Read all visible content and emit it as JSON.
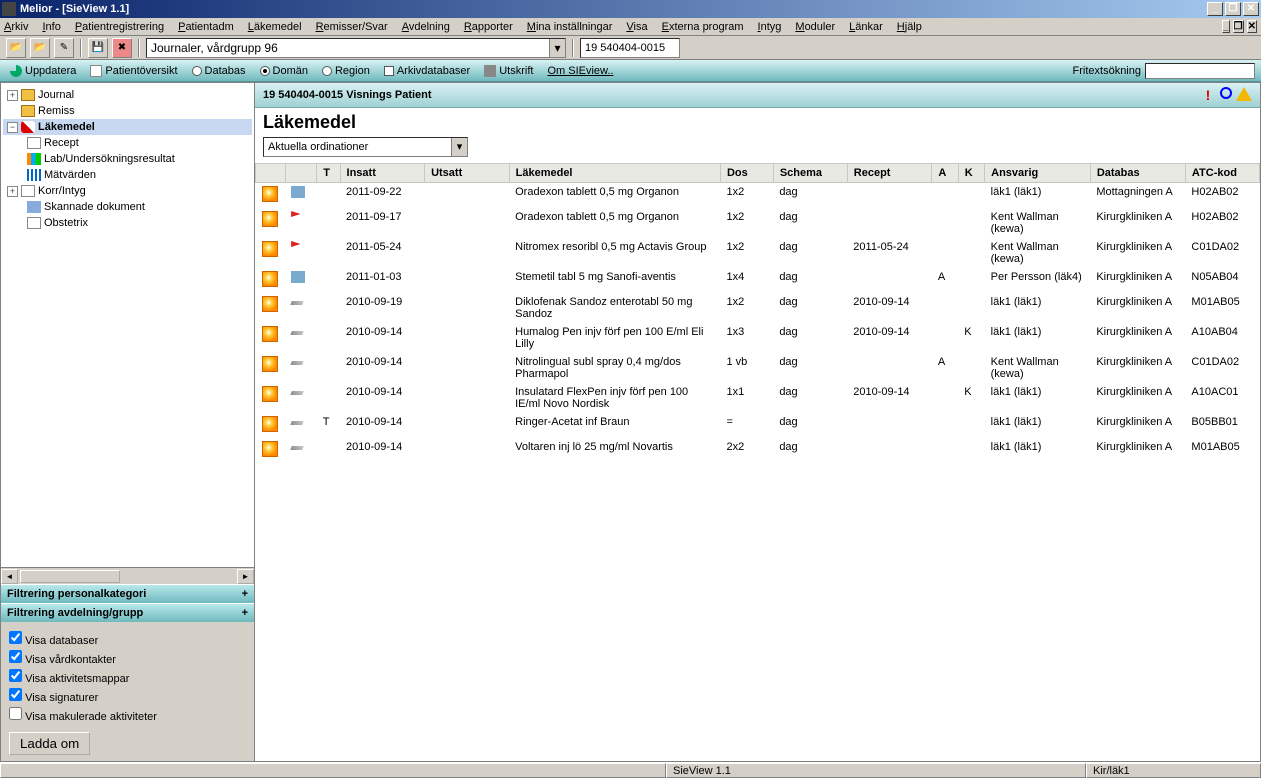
{
  "window": {
    "title": "Melior - [SieView 1.1]"
  },
  "menu": [
    "Arkiv",
    "Info",
    "Patientregistrering",
    "Patientadm",
    "Läkemedel",
    "Remisser/Svar",
    "Avdelning",
    "Rapporter",
    "Mina inställningar",
    "Visa",
    "Externa program",
    "Intyg",
    "Moduler",
    "Länkar",
    "Hjälp"
  ],
  "toolbar1": {
    "combo": "Journaler, vårdgrupp 96",
    "readout": "19 540404-0015"
  },
  "toolbar2": {
    "update": "Uppdatera",
    "overview": "Patientöversikt",
    "databas": "Databas",
    "doman": "Domän",
    "region": "Region",
    "arkiv": "Arkivdatabaser",
    "print": "Utskrift",
    "about": "Om SIEview..",
    "search_label": "Fritextsökning"
  },
  "tree": {
    "journal": "Journal",
    "remiss": "Remiss",
    "lakemedel": "Läkemedel",
    "recept": "Recept",
    "lab": "Lab/Undersökningsresultat",
    "matvarden": "Mätvärden",
    "korr": "Korr/Intyg",
    "skannade": "Skannade dokument",
    "obstetrix": "Obstetrix"
  },
  "filters": {
    "header1": "Filtrering personalkategori",
    "header2": "Filtrering avdelning/grupp",
    "opt1": "Visa databaser",
    "opt2": "Visa vårdkontakter",
    "opt3": "Visa aktivitetsmappar",
    "opt4": "Visa signaturer",
    "opt5": "Visa makulerade aktiviteter",
    "reload": "Ladda om"
  },
  "patient": {
    "header": "19 540404-0015 Visnings Patient",
    "section": "Läkemedel",
    "dropdown": "Aktuella ordinationer"
  },
  "columns": {
    "c0": "",
    "c1": "",
    "c2": "T",
    "c3": "Insatt",
    "c4": "Utsatt",
    "c5": "Läkemedel",
    "c6": "Dos",
    "c7": "Schema",
    "c8": "Recept",
    "c9": "A",
    "c10": "K",
    "c11": "Ansvarig",
    "c12": "Databas",
    "c13": "ATC-kod"
  },
  "rows": [
    {
      "ico": "people",
      "t": "",
      "insatt": "2011-09-22",
      "utsatt": "",
      "lak": "Oradexon tablett 0,5 mg Organon",
      "dos": "1x2",
      "schema": "dag",
      "recept": "",
      "a": "",
      "k": "",
      "ansvarig": "läk1 (läk1)",
      "databas": "Mottagningen A",
      "atc": "H02AB02"
    },
    {
      "ico": "flag",
      "t": "",
      "insatt": "2011-09-17",
      "utsatt": "",
      "lak": "Oradexon tablett 0,5 mg Organon",
      "dos": "1x2",
      "schema": "dag",
      "recept": "",
      "a": "",
      "k": "",
      "ansvarig": "Kent Wallman (kewa)",
      "databas": "Kirurgkliniken A",
      "atc": "H02AB02"
    },
    {
      "ico": "flag",
      "t": "",
      "insatt": "2011-05-24",
      "utsatt": "",
      "lak": "Nitromex resoribl 0,5 mg Actavis Group",
      "dos": "1x2",
      "schema": "dag",
      "recept": "2011-05-24",
      "a": "",
      "k": "",
      "ansvarig": "Kent Wallman (kewa)",
      "databas": "Kirurgkliniken A",
      "atc": "C01DA02"
    },
    {
      "ico": "people",
      "t": "",
      "insatt": "2011-01-03",
      "utsatt": "",
      "lak": "Stemetil tabl 5 mg Sanofi-aventis",
      "dos": "1x4",
      "schema": "dag",
      "recept": "",
      "a": "A",
      "k": "",
      "ansvarig": "Per Persson (läk4)",
      "databas": "Kirurgkliniken A",
      "atc": "N05AB04"
    },
    {
      "ico": "pen",
      "t": "",
      "insatt": "2010-09-19",
      "utsatt": "",
      "lak": "Diklofenak Sandoz enterotabl 50 mg Sandoz",
      "dos": "1x2",
      "schema": "dag",
      "recept": "2010-09-14",
      "a": "",
      "k": "",
      "ansvarig": "läk1 (läk1)",
      "databas": "Kirurgkliniken A",
      "atc": "M01AB05"
    },
    {
      "ico": "pen",
      "t": "",
      "insatt": "2010-09-14",
      "utsatt": "",
      "lak": "Humalog Pen injv förf pen 100 E/ml Eli Lilly",
      "dos": "1x3",
      "schema": "dag",
      "recept": "2010-09-14",
      "a": "",
      "k": "K",
      "ansvarig": "läk1 (läk1)",
      "databas": "Kirurgkliniken A",
      "atc": "A10AB04"
    },
    {
      "ico": "pen",
      "t": "",
      "insatt": "2010-09-14",
      "utsatt": "",
      "lak": "Nitrolingual subl spray 0,4 mg/dos Pharmapol",
      "dos": "1 vb",
      "schema": "dag",
      "recept": "",
      "a": "A",
      "k": "",
      "ansvarig": "Kent Wallman (kewa)",
      "databas": "Kirurgkliniken A",
      "atc": "C01DA02"
    },
    {
      "ico": "pen",
      "t": "",
      "insatt": "2010-09-14",
      "utsatt": "",
      "lak": "Insulatard FlexPen injv förf pen 100 IE/ml Novo Nordisk",
      "dos": "1x1",
      "schema": "dag",
      "recept": "2010-09-14",
      "a": "",
      "k": "K",
      "ansvarig": "läk1 (läk1)",
      "databas": "Kirurgkliniken A",
      "atc": "A10AC01"
    },
    {
      "ico": "pen",
      "t": "T",
      "insatt": "2010-09-14",
      "utsatt": "",
      "lak": "Ringer-Acetat inf Braun",
      "dos": "=",
      "schema": "dag",
      "recept": "",
      "a": "",
      "k": "",
      "ansvarig": "läk1 (läk1)",
      "databas": "Kirurgkliniken A",
      "atc": "B05BB01"
    },
    {
      "ico": "pen",
      "t": "",
      "insatt": "2010-09-14",
      "utsatt": "",
      "lak": "Voltaren inj lö 25 mg/ml Novartis",
      "dos": "2x2",
      "schema": "dag",
      "recept": "",
      "a": "",
      "k": "",
      "ansvarig": "läk1 (läk1)",
      "databas": "Kirurgkliniken A",
      "atc": "M01AB05"
    }
  ],
  "status": {
    "app": "SieView 1.1",
    "user": "Kir/läk1"
  }
}
